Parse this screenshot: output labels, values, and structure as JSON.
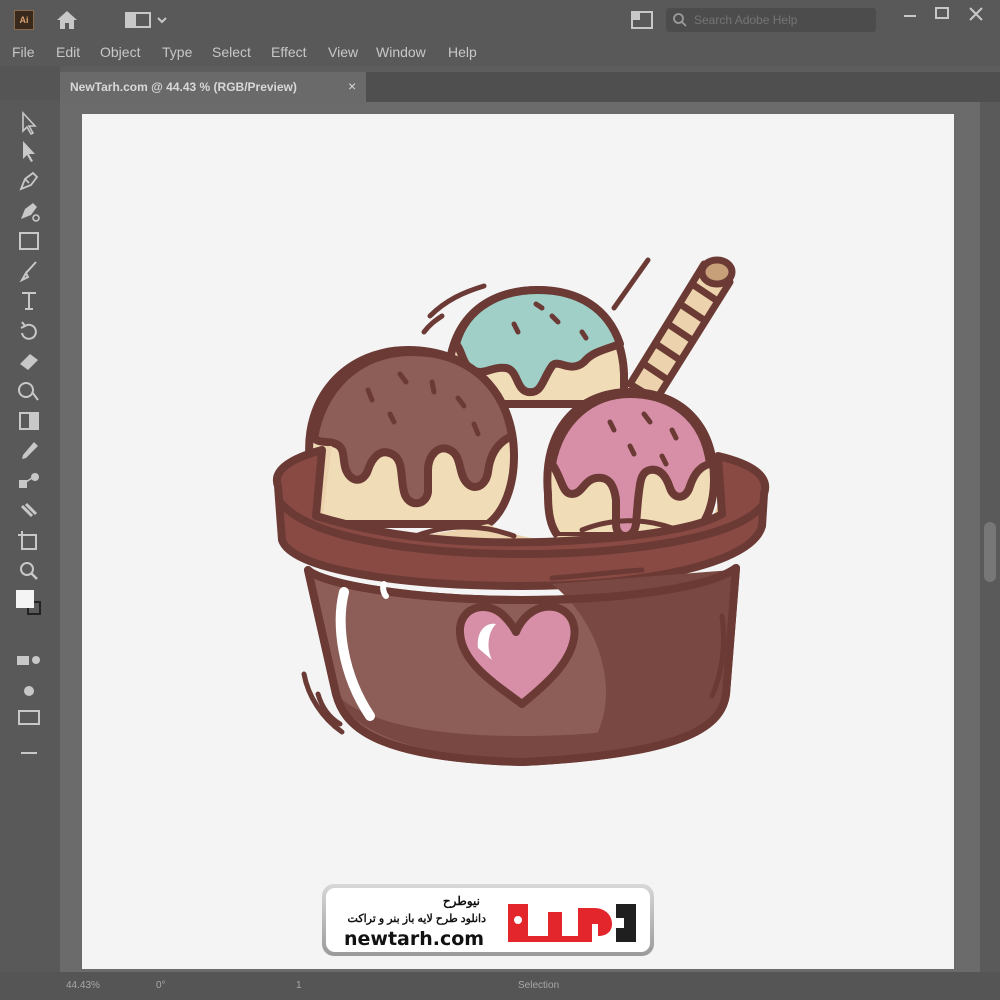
{
  "app": {
    "logo_text": "Ai",
    "menu": [
      "File",
      "Edit",
      "Object",
      "Type",
      "Select",
      "Effect",
      "View",
      "Window",
      "Help"
    ],
    "search_placeholder": "Search Adobe Help"
  },
  "document": {
    "tab_label": "NewTarh.com @ 44.43 % (RGB/Preview)",
    "close_glyph": "×"
  },
  "status": {
    "zoom": "44.43%",
    "rotation": "0°",
    "artboard_number": "1",
    "tool": "Selection"
  },
  "watermark": {
    "brand_fa": "نیوطرح",
    "tagline_fa": "دانلود طرح لایه باز بنر و تراکت",
    "domain": "newtarh.com"
  },
  "colors": {
    "chrome": "#595959",
    "outline": "#6b3a35",
    "cup": "#8a4a44",
    "cream": "#f1dcb8",
    "chocolate": "#8d5e58",
    "mint": "#9fcfc6",
    "pink": "#d68fa6",
    "brand_red": "#e3262b"
  },
  "icons": [
    "home-icon",
    "workspace-icon",
    "arrange-icon",
    "search-icon",
    "minimize-icon",
    "restore-icon",
    "close-icon"
  ],
  "tools": [
    "selection-tool",
    "direct-selection-tool",
    "pen-tool",
    "curvature-tool",
    "rectangle-tool",
    "paintbrush-tool",
    "type-tool",
    "rotate-tool",
    "eraser-tool",
    "shape-builder-tool",
    "gradient-tool",
    "eyedropper-tool",
    "blend-tool",
    "symbol-sprayer-tool",
    "artboard-tool",
    "zoom-tool",
    "fill-stroke-swatch",
    "draw-mode",
    "screen-mode",
    "edit-toolbar"
  ]
}
